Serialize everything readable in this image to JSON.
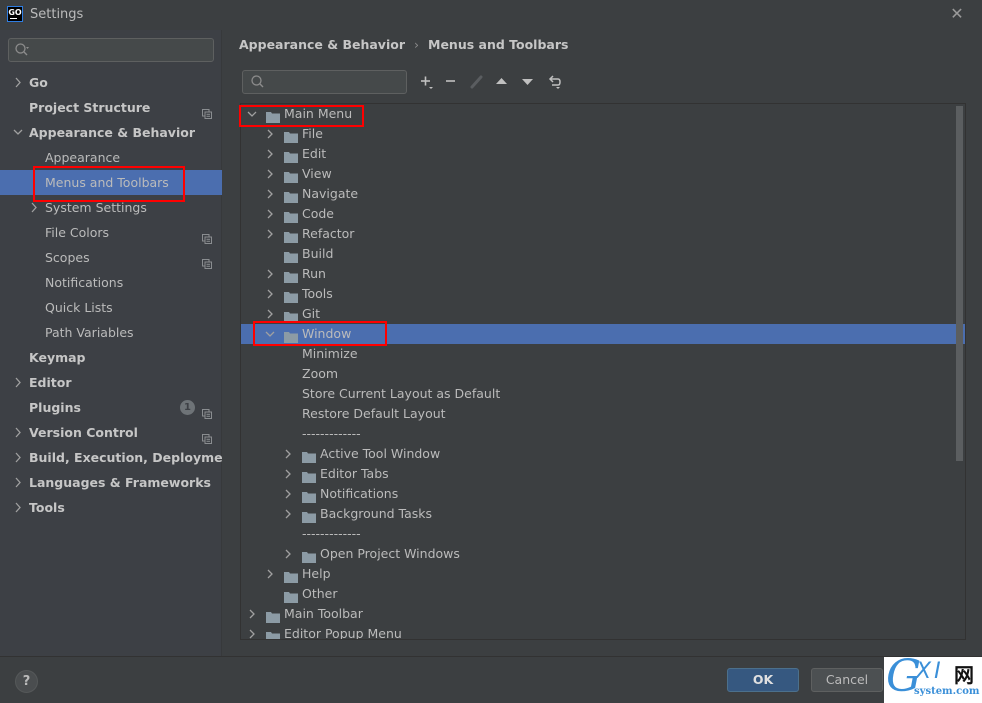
{
  "window": {
    "title": "Settings",
    "logo_text": "GO"
  },
  "sidebar": {
    "search_placeholder": "",
    "items": [
      {
        "label": "Go",
        "level": 0,
        "bold": true,
        "chevron": "right",
        "selected": false,
        "project_icon": false
      },
      {
        "label": "Project Structure",
        "level": 0,
        "bold": true,
        "chevron": "none",
        "selected": false,
        "project_icon": true
      },
      {
        "label": "Appearance & Behavior",
        "level": 0,
        "bold": true,
        "chevron": "down",
        "selected": false,
        "project_icon": false
      },
      {
        "label": "Appearance",
        "level": 1,
        "bold": false,
        "chevron": "none",
        "selected": false,
        "project_icon": false
      },
      {
        "label": "Menus and Toolbars",
        "level": 1,
        "bold": false,
        "chevron": "none",
        "selected": true,
        "project_icon": false
      },
      {
        "label": "System Settings",
        "level": 1,
        "bold": false,
        "chevron": "right",
        "selected": false,
        "project_icon": false
      },
      {
        "label": "File Colors",
        "level": 1,
        "bold": false,
        "chevron": "none",
        "selected": false,
        "project_icon": true
      },
      {
        "label": "Scopes",
        "level": 1,
        "bold": false,
        "chevron": "none",
        "selected": false,
        "project_icon": true
      },
      {
        "label": "Notifications",
        "level": 1,
        "bold": false,
        "chevron": "none",
        "selected": false,
        "project_icon": false
      },
      {
        "label": "Quick Lists",
        "level": 1,
        "bold": false,
        "chevron": "none",
        "selected": false,
        "project_icon": false
      },
      {
        "label": "Path Variables",
        "level": 1,
        "bold": false,
        "chevron": "none",
        "selected": false,
        "project_icon": false
      },
      {
        "label": "Keymap",
        "level": 0,
        "bold": true,
        "chevron": "none",
        "selected": false,
        "project_icon": false
      },
      {
        "label": "Editor",
        "level": 0,
        "bold": true,
        "chevron": "right",
        "selected": false,
        "project_icon": false
      },
      {
        "label": "Plugins",
        "level": 0,
        "bold": true,
        "chevron": "none",
        "selected": false,
        "project_icon": true,
        "badge": "1"
      },
      {
        "label": "Version Control",
        "level": 0,
        "bold": true,
        "chevron": "right",
        "selected": false,
        "project_icon": true
      },
      {
        "label": "Build, Execution, Deployment",
        "level": 0,
        "bold": true,
        "chevron": "right",
        "selected": false,
        "project_icon": false
      },
      {
        "label": "Languages & Frameworks",
        "level": 0,
        "bold": true,
        "chevron": "right",
        "selected": false,
        "project_icon": false
      },
      {
        "label": "Tools",
        "level": 0,
        "bold": true,
        "chevron": "right",
        "selected": false,
        "project_icon": false
      }
    ]
  },
  "main": {
    "breadcrumb": [
      "Appearance & Behavior",
      "Menus and Toolbars"
    ],
    "breadcrumb_separator": "›",
    "search_placeholder": "",
    "toolbar": [
      {
        "name": "add-button",
        "icon": "plus-icon",
        "enabled": true
      },
      {
        "name": "remove-button",
        "icon": "minus-icon",
        "enabled": true
      },
      {
        "name": "edit-button",
        "icon": "pencil-icon",
        "enabled": false
      },
      {
        "name": "move-up-button",
        "icon": "triangle-up-icon",
        "enabled": true
      },
      {
        "name": "move-down-button",
        "icon": "triangle-down-icon",
        "enabled": true
      },
      {
        "name": "restore-button",
        "icon": "restore-icon",
        "enabled": true
      }
    ],
    "tree": [
      {
        "label": "Main Menu",
        "depth": 0,
        "chevron": "down",
        "folder": true,
        "selected": false
      },
      {
        "label": "File",
        "depth": 1,
        "chevron": "right",
        "folder": true,
        "selected": false
      },
      {
        "label": "Edit",
        "depth": 1,
        "chevron": "right",
        "folder": true,
        "selected": false
      },
      {
        "label": "View",
        "depth": 1,
        "chevron": "right",
        "folder": true,
        "selected": false
      },
      {
        "label": "Navigate",
        "depth": 1,
        "chevron": "right",
        "folder": true,
        "selected": false
      },
      {
        "label": "Code",
        "depth": 1,
        "chevron": "right",
        "folder": true,
        "selected": false
      },
      {
        "label": "Refactor",
        "depth": 1,
        "chevron": "right",
        "folder": true,
        "selected": false
      },
      {
        "label": "Build",
        "depth": 1,
        "chevron": "none",
        "folder": true,
        "selected": false
      },
      {
        "label": "Run",
        "depth": 1,
        "chevron": "right",
        "folder": true,
        "selected": false
      },
      {
        "label": "Tools",
        "depth": 1,
        "chevron": "right",
        "folder": true,
        "selected": false
      },
      {
        "label": "Git",
        "depth": 1,
        "chevron": "right",
        "folder": true,
        "selected": false
      },
      {
        "label": "Window",
        "depth": 1,
        "chevron": "down",
        "folder": true,
        "selected": true
      },
      {
        "label": "Minimize",
        "depth": 2,
        "chevron": "none",
        "folder": false,
        "selected": false
      },
      {
        "label": "Zoom",
        "depth": 2,
        "chevron": "none",
        "folder": false,
        "selected": false
      },
      {
        "label": "Store Current Layout as Default",
        "depth": 2,
        "chevron": "none",
        "folder": false,
        "selected": false
      },
      {
        "label": "Restore Default Layout",
        "depth": 2,
        "chevron": "none",
        "folder": false,
        "selected": false
      },
      {
        "label": "-------------",
        "depth": 2,
        "chevron": "none",
        "folder": false,
        "selected": false,
        "separator": true
      },
      {
        "label": "Active Tool Window",
        "depth": 2,
        "chevron": "right",
        "folder": true,
        "selected": false
      },
      {
        "label": "Editor Tabs",
        "depth": 2,
        "chevron": "right",
        "folder": true,
        "selected": false
      },
      {
        "label": "Notifications",
        "depth": 2,
        "chevron": "right",
        "folder": true,
        "selected": false
      },
      {
        "label": "Background Tasks",
        "depth": 2,
        "chevron": "right",
        "folder": true,
        "selected": false
      },
      {
        "label": "-------------",
        "depth": 2,
        "chevron": "none",
        "folder": false,
        "selected": false,
        "separator": true
      },
      {
        "label": "Open Project Windows",
        "depth": 2,
        "chevron": "right",
        "folder": true,
        "selected": false
      },
      {
        "label": "Help",
        "depth": 1,
        "chevron": "right",
        "folder": true,
        "selected": false
      },
      {
        "label": "Other",
        "depth": 1,
        "chevron": "none",
        "folder": true,
        "selected": false
      },
      {
        "label": "Main Toolbar",
        "depth": 0,
        "chevron": "right",
        "folder": true,
        "selected": false
      },
      {
        "label": "Editor Popup Menu",
        "depth": 0,
        "chevron": "right",
        "folder": true,
        "selected": false
      }
    ]
  },
  "footer": {
    "help_label": "?",
    "ok_label": "OK",
    "cancel_label": "Cancel"
  },
  "watermark": {
    "g": "G",
    "xi": "XI",
    "wang": "网",
    "domain": "system.com"
  },
  "colors": {
    "selection": "#4b6eaf",
    "annotation": "#ff0000",
    "ok_button": "#365880"
  }
}
